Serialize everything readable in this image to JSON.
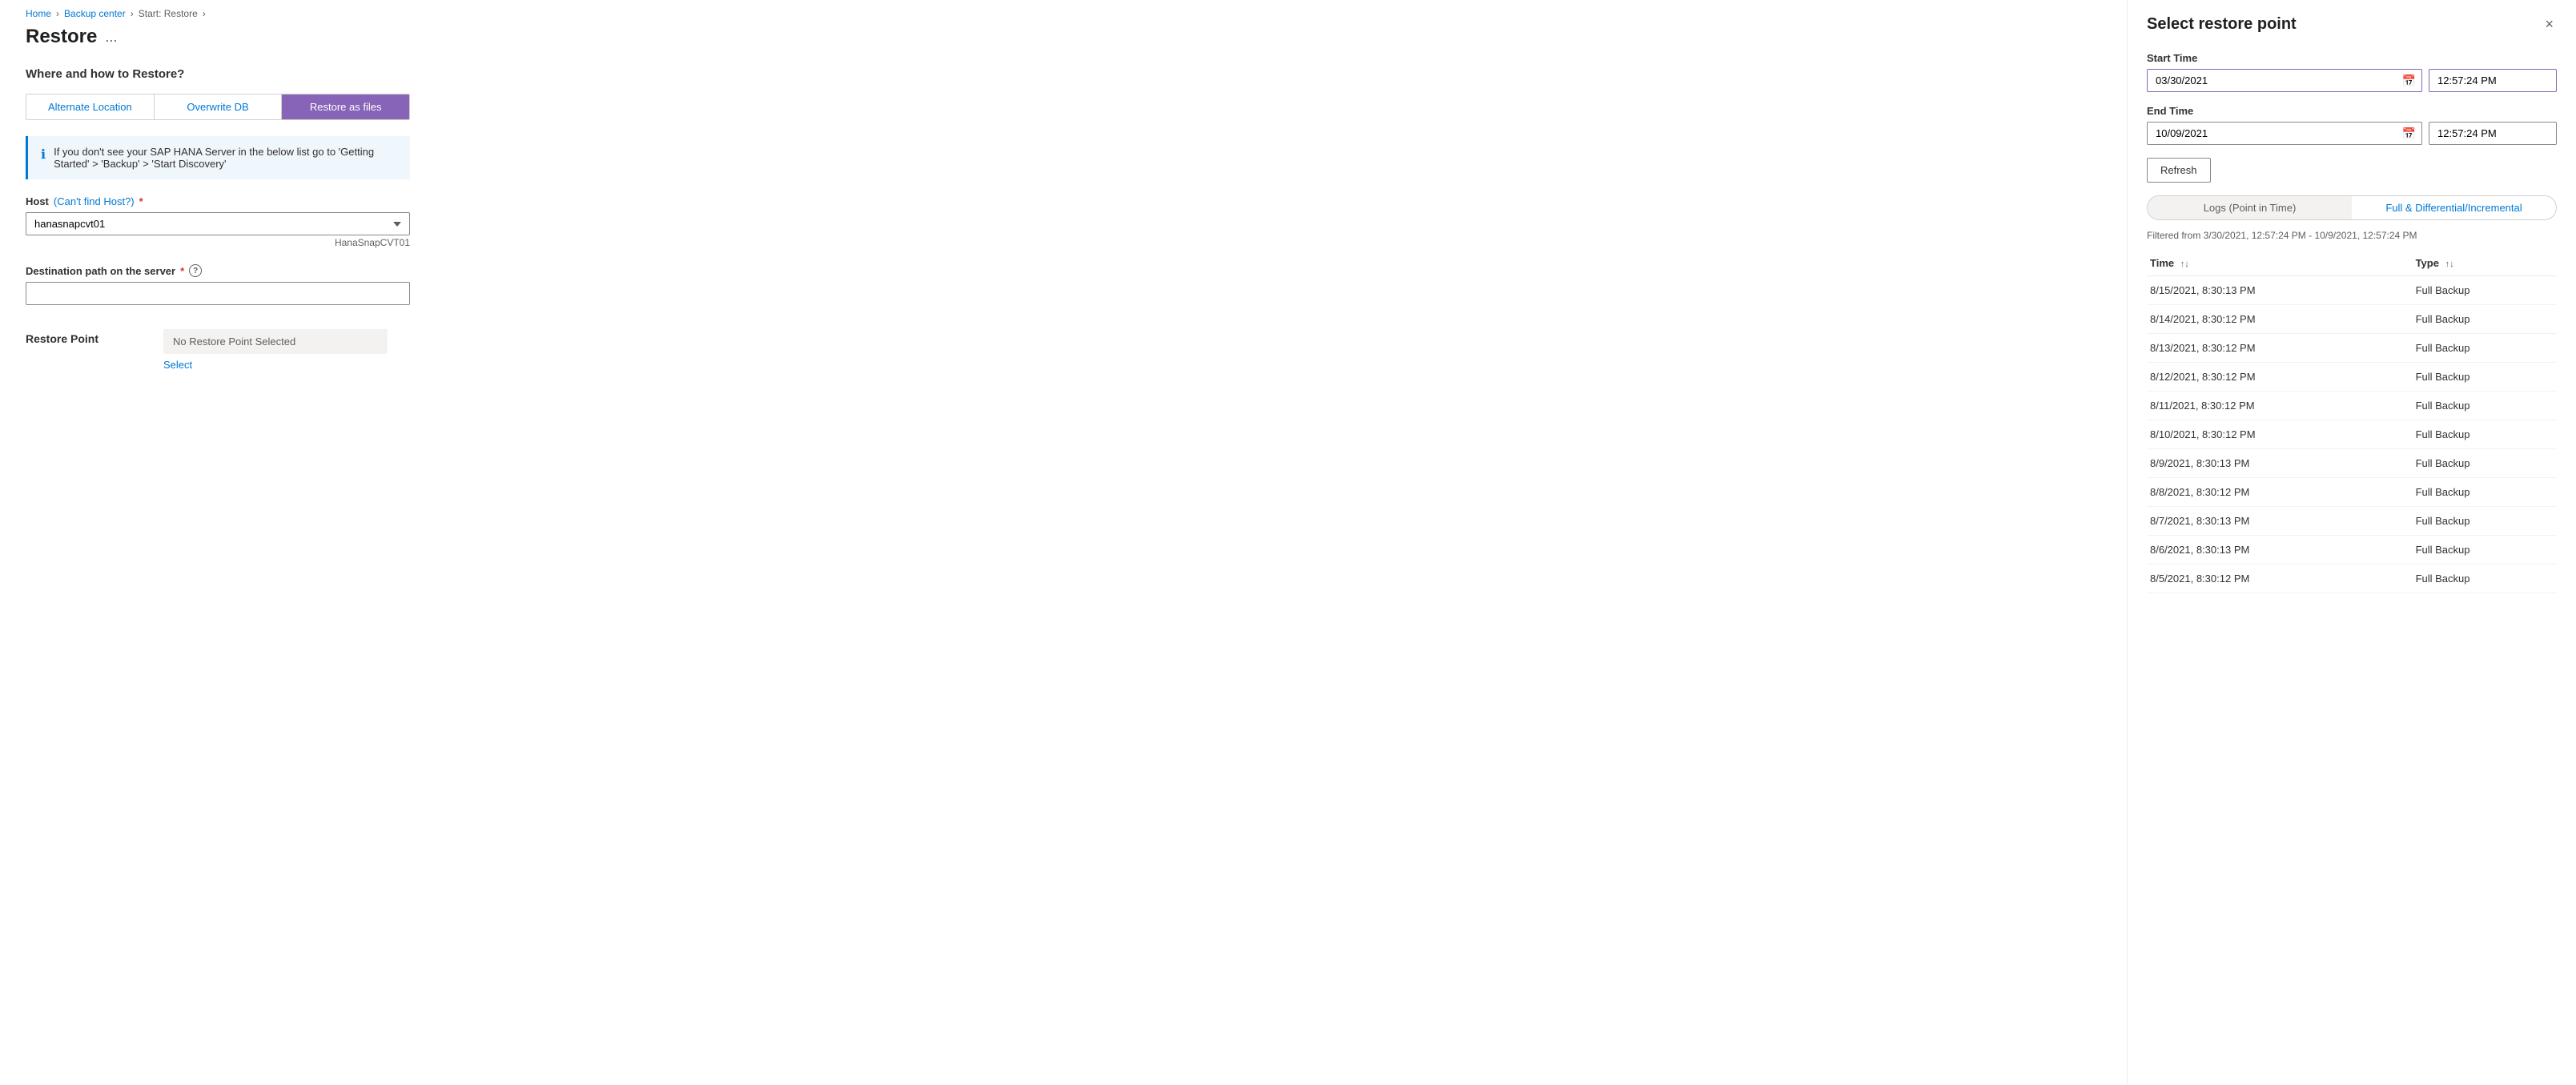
{
  "breadcrumb": {
    "items": [
      {
        "label": "Home",
        "href": "#"
      },
      {
        "label": "Backup center",
        "href": "#"
      },
      {
        "label": "Start: Restore",
        "href": "#"
      }
    ],
    "separators": [
      ">",
      ">",
      ">"
    ]
  },
  "page": {
    "title": "Restore",
    "ellipsis": "..."
  },
  "where_how": {
    "section_title": "Where and how to Restore?",
    "tabs": [
      {
        "label": "Alternate Location",
        "active": false
      },
      {
        "label": "Overwrite DB",
        "active": false
      },
      {
        "label": "Restore as files",
        "active": true
      }
    ]
  },
  "info_box": {
    "text": "If you don't see your SAP HANA Server in the below list go to 'Getting Started' > 'Backup' > 'Start Discovery'"
  },
  "host_field": {
    "label": "Host",
    "link_label": "(Can't find Host?)",
    "value": "hanasnapcvt01",
    "hint": "HanaSnapCVT01"
  },
  "dest_path_field": {
    "label": "Destination path on the server",
    "placeholder": ""
  },
  "restore_point": {
    "label": "Restore Point",
    "no_selection_text": "No Restore Point Selected",
    "select_link": "Select"
  },
  "right_panel": {
    "title": "Select restore point",
    "close_label": "×",
    "start_time": {
      "label": "Start Time",
      "date": "03/30/2021",
      "time": "12:57:24 PM"
    },
    "end_time": {
      "label": "End Time",
      "date": "10/09/2021",
      "time": "12:57:24 PM"
    },
    "refresh_label": "Refresh",
    "tabs": [
      {
        "label": "Logs (Point in Time)",
        "active": false
      },
      {
        "label": "Full & Differential/Incremental",
        "active": true
      }
    ],
    "filter_info": "Filtered from 3/30/2021, 12:57:24 PM - 10/9/2021, 12:57:24 PM",
    "table": {
      "columns": [
        {
          "label": "Time",
          "sort": true
        },
        {
          "label": "Type",
          "sort": true
        }
      ],
      "rows": [
        {
          "time": "8/15/2021, 8:30:13 PM",
          "type": "Full Backup"
        },
        {
          "time": "8/14/2021, 8:30:12 PM",
          "type": "Full Backup"
        },
        {
          "time": "8/13/2021, 8:30:12 PM",
          "type": "Full Backup"
        },
        {
          "time": "8/12/2021, 8:30:12 PM",
          "type": "Full Backup"
        },
        {
          "time": "8/11/2021, 8:30:12 PM",
          "type": "Full Backup"
        },
        {
          "time": "8/10/2021, 8:30:12 PM",
          "type": "Full Backup"
        },
        {
          "time": "8/9/2021, 8:30:13 PM",
          "type": "Full Backup"
        },
        {
          "time": "8/8/2021, 8:30:12 PM",
          "type": "Full Backup"
        },
        {
          "time": "8/7/2021, 8:30:13 PM",
          "type": "Full Backup"
        },
        {
          "time": "8/6/2021, 8:30:13 PM",
          "type": "Full Backup"
        },
        {
          "time": "8/5/2021, 8:30:12 PM",
          "type": "Full Backup"
        }
      ]
    }
  }
}
